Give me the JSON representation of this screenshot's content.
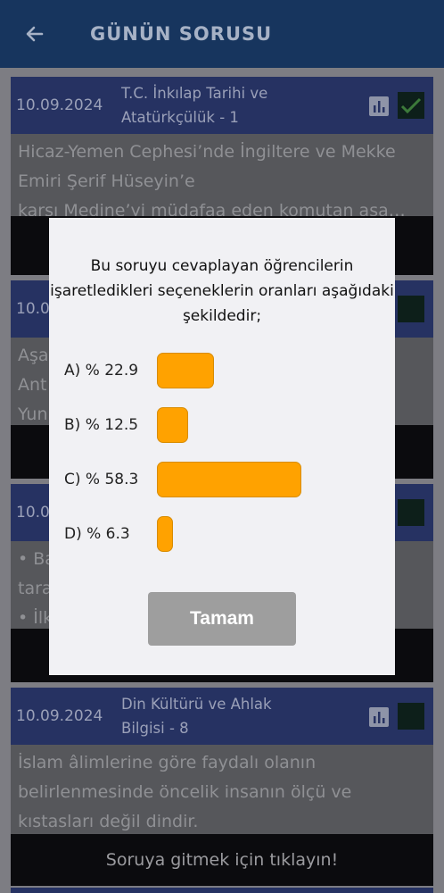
{
  "header": {
    "title": "GÜNÜN SORUSU"
  },
  "cards": [
    {
      "date": "10.09.2024",
      "subject": "T.C. İnkılap Tarihi ve Atatürkçülük - 1",
      "text": "Hicaz-Yemen Cephesi’nde İngiltere ve Mekke Emiri Şerif Hüseyin’e\nkarşı Medine’yi müdafaa eden komutan aşa…",
      "answered": true,
      "footer": ""
    },
    {
      "date": "10.0",
      "subject": "",
      "text": "Aşa                                                                    \nAnt                                                              ürk-\nYun                                                              rd…",
      "answered": false,
      "footer": ""
    },
    {
      "date": "10.0",
      "subject": "",
      "text": "• Ba\ntara\n• İlk                                                              cü…",
      "answered": false,
      "footer": ""
    },
    {
      "date": "10.09.2024",
      "subject": "Din Kültürü ve Ahlak Bilgisi - 8",
      "text": "İslam âlimlerine göre faydalı olanın belirlenmesinde öncelik insanın ölçü ve kıstasları değil dindir.",
      "answered": false,
      "footer": "Soruya gitmek için tıklayın!"
    }
  ],
  "dialog": {
    "message": "Bu soruyu cevaplayan öğrencilerin işaretledikleri seçeneklerin oranları aşağıdaki şekildedir;",
    "options": [
      {
        "label": "A) % 22.9",
        "percent": 22.9
      },
      {
        "label": "B) % 12.5",
        "percent": 12.5
      },
      {
        "label": "C) % 58.3",
        "percent": 58.3
      },
      {
        "label": "D) % 6.3",
        "percent": 6.3
      }
    ],
    "ok_label": "Tamam",
    "bar_color": "#ffa200"
  },
  "colors": {
    "appbar": "#17355e",
    "card_header": "#263262",
    "bar": "#ffa200"
  }
}
